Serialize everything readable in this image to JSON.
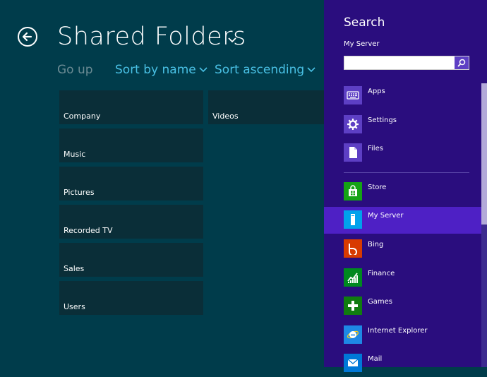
{
  "app": {
    "title": "Shared Folders",
    "commands": {
      "go_up": "Go up",
      "sort_name": "Sort by name",
      "sort_asc": "Sort ascending"
    },
    "folders": [
      "Company",
      "Music",
      "Pictures",
      "Recorded TV",
      "Sales",
      "Users",
      "Videos"
    ]
  },
  "charm": {
    "title": "Search",
    "scope": "My Server",
    "search": {
      "value": "",
      "placeholder": ""
    },
    "categories": [
      {
        "label": "Apps",
        "icon": "keyboard-icon"
      },
      {
        "label": "Settings",
        "icon": "gear-icon"
      },
      {
        "label": "Files",
        "icon": "file-icon"
      }
    ],
    "apps": [
      {
        "label": "Store",
        "icon": "store-icon",
        "color": "#15a315"
      },
      {
        "label": "My Server",
        "icon": "server-icon",
        "color": "#00a2ec",
        "selected": true
      },
      {
        "label": "Bing",
        "icon": "bing-icon",
        "color": "#d83b01"
      },
      {
        "label": "Finance",
        "icon": "finance-icon",
        "color": "#00891f"
      },
      {
        "label": "Games",
        "icon": "games-icon",
        "color": "#107c10"
      },
      {
        "label": "Internet Explorer",
        "icon": "ie-icon",
        "color": "#1e88e5"
      },
      {
        "label": "Mail",
        "icon": "mail-icon",
        "color": "#0078d7"
      }
    ]
  },
  "colors": {
    "app_bg": "#003c4b",
    "tile": "#0a2e38",
    "accent": "#49c0e4",
    "charm_bg": "#2a0d7e",
    "selected": "#4e20c5",
    "category_icon_bg": "#5d3fc4"
  }
}
